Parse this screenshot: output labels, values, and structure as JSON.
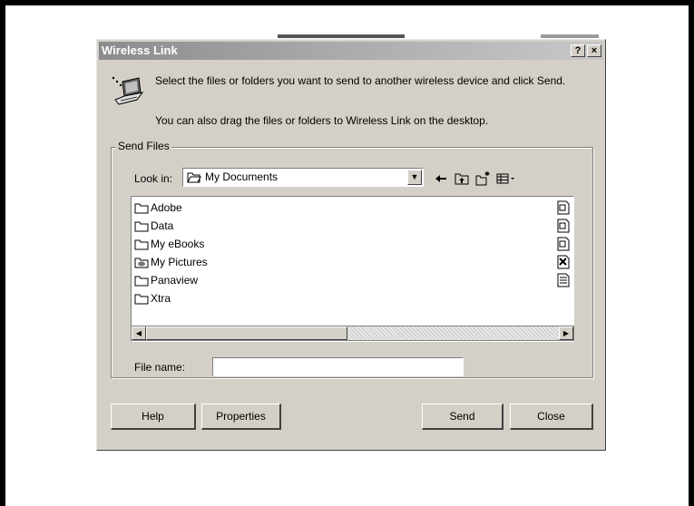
{
  "dialog": {
    "title": "Wireless Link",
    "help_button": "?",
    "close_button": "×"
  },
  "intro": {
    "line1": "Select the files or folders you want to send to another wireless device and click Send.",
    "line2": "You can also drag the files or folders to Wireless Link on the desktop."
  },
  "send_files": {
    "group_label": "Send Files",
    "look_in_label": "Look in:",
    "look_in_value": "My Documents",
    "items": [
      {
        "label": "Adobe",
        "icon": "folder-icon",
        "side_icon": "document-icon"
      },
      {
        "label": "Data",
        "icon": "folder-icon",
        "side_icon": "document-icon"
      },
      {
        "label": "My eBooks",
        "icon": "folder-icon",
        "side_icon": "document-icon"
      },
      {
        "label": "My Pictures",
        "icon": "picture-folder-icon",
        "side_icon": "image-document-icon"
      },
      {
        "label": "Panaview",
        "icon": "folder-icon",
        "side_icon": "text-document-icon"
      },
      {
        "label": "Xtra",
        "icon": "folder-icon",
        "side_icon": ""
      }
    ],
    "file_name_label": "File name:",
    "file_name_value": ""
  },
  "buttons": {
    "help": "Help",
    "properties": "Properties",
    "send": "Send",
    "close": "Close"
  }
}
